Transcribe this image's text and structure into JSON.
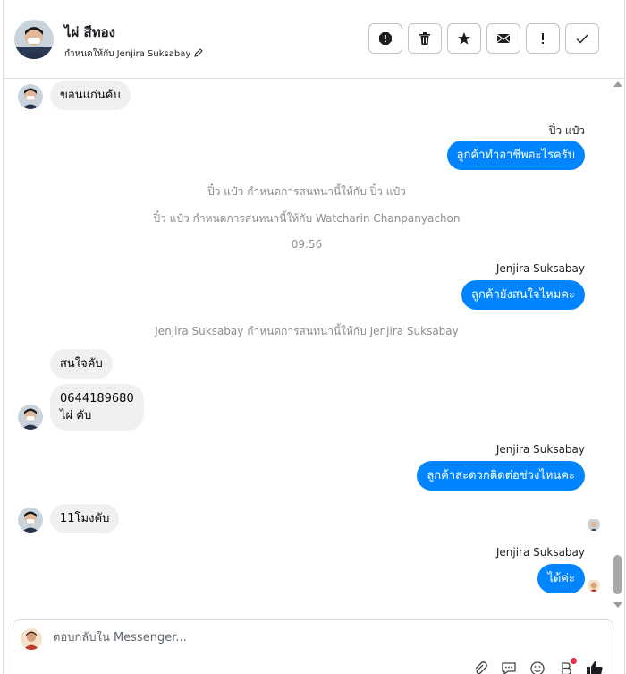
{
  "header": {
    "contact_name": "ไผ่ สีทอง",
    "assigned_text": "กำหนดให้กับ Jenjira Suksabay",
    "actions": [
      "report-icon",
      "trash-icon",
      "star-icon",
      "mail-icon",
      "exclamation-icon",
      "check-icon"
    ]
  },
  "messages": {
    "m1": "ขอนแก่นคับ",
    "sender1": "ปิ๋ว แป๋ว",
    "m2": "ลูกค้าทำอาชีพอะไรครับ",
    "sys1": "ปิ๋ว แป๋ว กำหนดการสนทนานี้ให้กับ ปิ๋ว แป๋ว",
    "sys2": "ปิ๋ว แป๋ว กำหนดการสนทนานี้ให้กับ Watcharin Chanpanyachon",
    "time1": "09:56",
    "sender2": "Jenjira Suksabay",
    "m3": "ลูกค้ายังสนใจไหมคะ",
    "sys3": "Jenjira Suksabay กำหนดการสนทนานี้ให้กับ Jenjira Suksabay",
    "m4": "สนใจคับ",
    "m5_line1": "0644189680",
    "m5_line2": "ไผ่ คับ",
    "sender3": "Jenjira Suksabay",
    "m6": "ลูกค้าสะดวกติดต่อช่วงไหนคะ",
    "m7": "11โมงคับ",
    "sender4": "Jenjira Suksabay",
    "m8": "ได้ค่ะ"
  },
  "composer": {
    "placeholder": "ตอบกลับใน Messenger...",
    "tools": [
      "paperclip-icon",
      "gif-icon",
      "emoji-icon",
      "sticker-icon",
      "thumbs-up-icon"
    ]
  },
  "colors": {
    "accent": "#0084ff",
    "incoming_bubble": "#f0f0f0",
    "system_text": "#8a8d91"
  }
}
